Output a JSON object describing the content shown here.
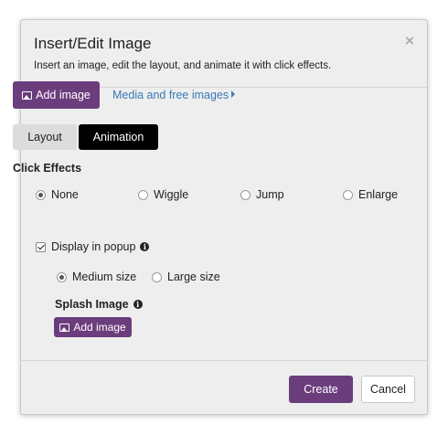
{
  "dialog": {
    "title": "Insert/Edit Image",
    "subtitle": "Insert an image, edit the layout, and animate it with click effects.",
    "close_symbol": "×"
  },
  "actions": {
    "add_image_label": "Add image",
    "media_link_label": "Media and free images"
  },
  "tabs": [
    {
      "label": "Layout",
      "active": false
    },
    {
      "label": "Animation",
      "active": true
    }
  ],
  "click_effects": {
    "title": "Click Effects",
    "options": [
      {
        "label": "None",
        "checked": true
      },
      {
        "label": "Wiggle",
        "checked": false
      },
      {
        "label": "Jump",
        "checked": false
      },
      {
        "label": "Enlarge",
        "checked": false
      }
    ]
  },
  "popup": {
    "label": "Display in popup",
    "checked": true,
    "sizes": [
      {
        "label": "Medium size",
        "checked": true
      },
      {
        "label": "Large size",
        "checked": false
      }
    ]
  },
  "splash": {
    "title": "Splash Image",
    "add_image_label": "Add image"
  },
  "footer": {
    "create_label": "Create",
    "cancel_label": "Cancel"
  },
  "colors": {
    "primary": "#6b3d7d",
    "link": "#3a78b5",
    "active_tab": "#000000",
    "dialog_bg": "#eeeeee"
  },
  "icons": [
    "image-icon",
    "caret-right-icon",
    "info-icon",
    "close-icon"
  ]
}
